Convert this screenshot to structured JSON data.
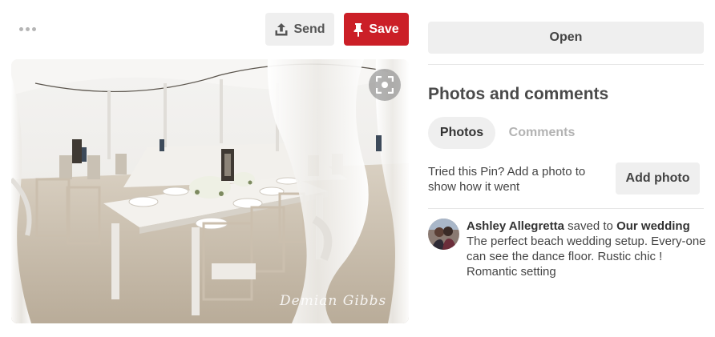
{
  "toolbar": {
    "more_icon": "more-horizontal-icon",
    "send_label": "Send",
    "send_icon": "share-upload-icon",
    "save_label": "Save",
    "save_icon": "pushpin-icon",
    "save_color": "#cb1f27"
  },
  "pin": {
    "watermark": "Demian Gibbs",
    "visual_search_icon": "visual-search-icon"
  },
  "sidebar": {
    "open_label": "Open",
    "section_title": "Photos and comments",
    "tabs": [
      {
        "label": "Photos",
        "active": true
      },
      {
        "label": "Comments",
        "active": false
      }
    ],
    "tried_text": "Tried this Pin? Add a photo to show how it went",
    "add_photo_label": "Add photo"
  },
  "activity": {
    "user_name": "Ashley Allegretta",
    "saved_to_text": "saved to",
    "board_name": "Our wedding",
    "description": "The perfect beach wedding setup. Every-one can see the dance floor. Rustic chic ! Romantic setting"
  }
}
